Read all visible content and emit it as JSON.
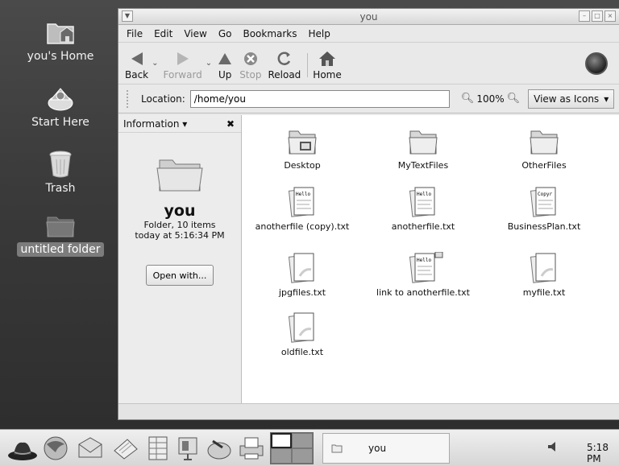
{
  "desktop": {
    "icons": [
      {
        "label": "you's Home"
      },
      {
        "label": "Start Here"
      },
      {
        "label": "Trash"
      },
      {
        "label": "untitled folder"
      }
    ]
  },
  "window": {
    "title": "you",
    "menu": [
      "File",
      "Edit",
      "View",
      "Go",
      "Bookmarks",
      "Help"
    ],
    "toolbar": {
      "back": "Back",
      "forward": "Forward",
      "up": "Up",
      "stop": "Stop",
      "reload": "Reload",
      "home": "Home"
    },
    "location": {
      "label": "Location:",
      "value": "/home/you",
      "zoom": "100%",
      "view_as": "View as Icons"
    },
    "sidepane": {
      "header": "Information",
      "name": "you",
      "line1": "Folder, 10 items",
      "line2": "today at 5:16:34 PM",
      "open_with": "Open with..."
    },
    "files": [
      {
        "name": "Desktop"
      },
      {
        "name": "MyTextFiles"
      },
      {
        "name": "OtherFiles"
      },
      {
        "name": "anotherfile (copy).txt",
        "preview": "Hello"
      },
      {
        "name": "anotherfile.txt",
        "preview": "Hello"
      },
      {
        "name": "BusinessPlan.txt",
        "preview": "Copyr"
      },
      {
        "name": "jpgfiles.txt"
      },
      {
        "name": "link to anotherfile.txt",
        "preview": "Hello"
      },
      {
        "name": "myfile.txt"
      },
      {
        "name": "oldfile.txt"
      }
    ]
  },
  "panel": {
    "task": "you",
    "clock": "5:18 PM"
  }
}
